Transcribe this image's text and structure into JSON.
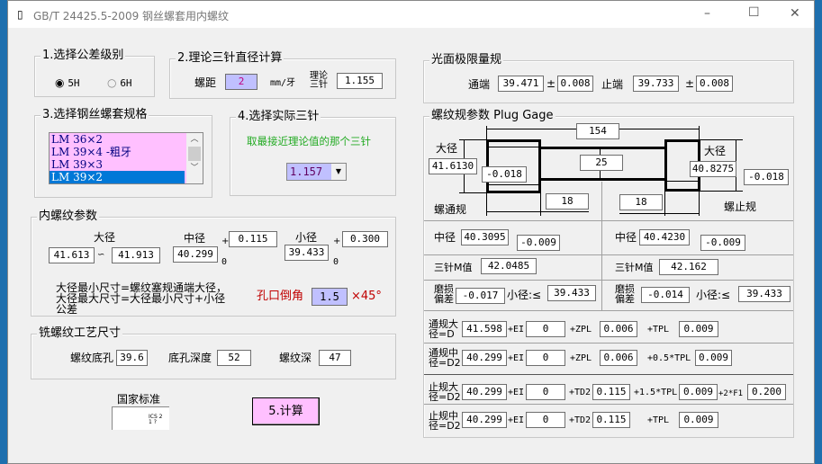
{
  "window": {
    "title": "GB/T 24425.5-2009 钢丝螺套用内螺纹",
    "minimize": "–",
    "maximize": "☐",
    "close": "✕"
  },
  "colors": {
    "accent_blue": "#c0c0ff",
    "pink": "#ffc0ff",
    "select": "#0078d7",
    "green": "#22aa22",
    "red": "#c00000"
  },
  "tolerance": {
    "title": "1.选择公差级别",
    "options": [
      "5H",
      "6H"
    ],
    "selected": "5H"
  },
  "pin_calc": {
    "title": "2.理论三针直径计算",
    "pitch_label": "螺距",
    "pitch": "2",
    "unit": "mm/牙",
    "theory_label": "理论三针",
    "theory_value": "1.155"
  },
  "spec": {
    "title": "3.选择钢丝螺套规格",
    "items": [
      "LM 36×2",
      "LM 39×4 -粗牙",
      "LM 39×3",
      "LM 39×2"
    ],
    "selected": "LM 39×2"
  },
  "actual_pin": {
    "title": "4.选择实际三针",
    "hint": "取最接近理论值的那个三针",
    "value": "1.157"
  },
  "internal": {
    "title": "内螺纹参数",
    "major_label": "大径",
    "major_min": "41.613",
    "range_sym": "∽",
    "major_max": "41.913",
    "pitch_label": "中径",
    "pitch_value": "40.299",
    "pitch_upper": "0.115",
    "pitch_lower": "0",
    "minor_label": "小径",
    "minor_value": "39.433",
    "minor_upper": "0.300",
    "minor_lower": "0",
    "plus": "+",
    "note": "大径最小尺寸=螺纹塞规通端大径，大径最大尺寸=大径最小尺寸+小径公差",
    "chamfer_label": "孔口倒角",
    "chamfer": "1.5",
    "chamfer_suffix": "×45°"
  },
  "milling": {
    "title": "铣螺纹工艺尺寸",
    "hole_label": "螺纹底孔",
    "hole": "39.6",
    "depth_label": "底孔深度",
    "depth": "52",
    "thread_label": "螺纹深",
    "thread": "47"
  },
  "standard": {
    "label": "国家标准",
    "preview": "ICS 2\n1 ?"
  },
  "calc_button": "5.计算",
  "plain_gauge": {
    "title": "光面极限量规",
    "go_label": "通端",
    "go": "39.471",
    "go_tol": "0.008",
    "nogo_label": "止端",
    "nogo": "39.733",
    "nogo_tol": "0.008",
    "pm": "±"
  },
  "plug": {
    "title": "螺纹规参数 Plug Gage",
    "length": "154",
    "mid": "25",
    "left_len": "18",
    "right_len": "18",
    "go": {
      "name": "螺通规",
      "major_label": "大径",
      "major": "41.6130",
      "major_dev": "-0.018",
      "pitch_label": "中径",
      "pitch": "40.3095",
      "pitch_dev": "-0.009",
      "m_label": "三针M值",
      "m": "42.0485",
      "wear_label": "磨损偏差",
      "wear": "-0.017",
      "minor_label": "小径:≤",
      "minor": "39.433"
    },
    "nogo": {
      "name": "螺止规",
      "major_label": "大径",
      "major": "40.8275",
      "major_dev": "-0.018",
      "pitch_label": "中径",
      "pitch": "40.4230",
      "pitch_dev": "-0.009",
      "m_label": "三针M值",
      "m": "42.162",
      "wear_label": "磨损偏差",
      "wear": "-0.014",
      "minor_label": "小径:≤",
      "minor": "39.433"
    },
    "rows": [
      {
        "label": "通规大径=D",
        "v1": "41.598",
        "l2": "+EI",
        "v2": "0",
        "l3": "+ZPL",
        "v3": "0.006",
        "l4": "+TPL",
        "v4": "0.009"
      },
      {
        "label": "通规中径=D2",
        "v1": "40.299",
        "l2": "+EI",
        "v2": "0",
        "l3": "+ZPL",
        "v3": "0.006",
        "l4": "+0.5*TPL",
        "v4": "0.009"
      },
      {
        "label": "止规大径=D2",
        "v1": "40.299",
        "l2": "+EI",
        "v2": "0",
        "l3": "+TD2",
        "v3": "0.115",
        "l4": "+1.5*TPL",
        "v4": "0.009",
        "l5": "+2*F1",
        "v5": "0.200"
      },
      {
        "label": "止规中径=D2",
        "v1": "40.299",
        "l2": "+EI",
        "v2": "0",
        "l3": "+TD2",
        "v3": "0.115",
        "l4": "+TPL",
        "v4": "0.009"
      }
    ]
  }
}
